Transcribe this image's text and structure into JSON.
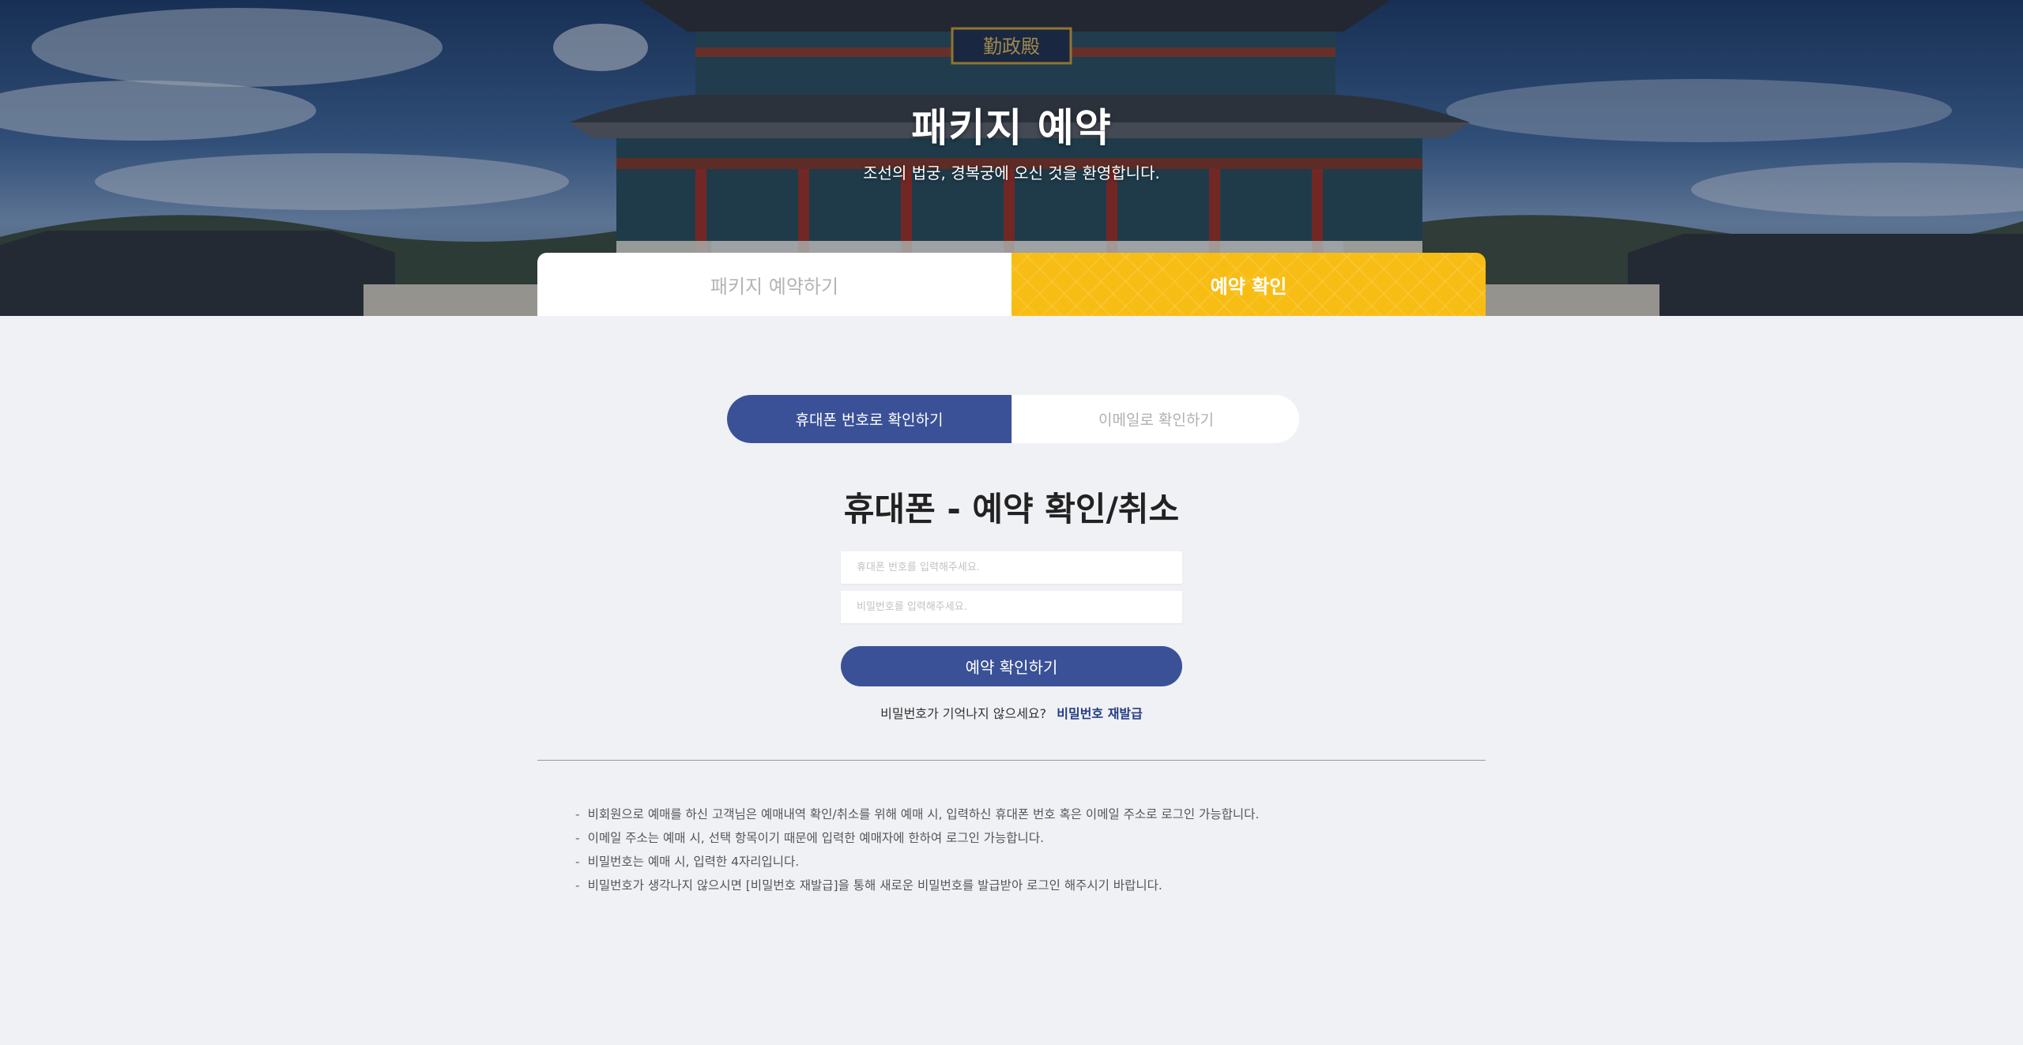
{
  "hero": {
    "title": "패키지 예약",
    "subtitle": "조선의 법궁, 경복궁에 오신 것을 환영합니다.",
    "signboard_text": "勤政殿"
  },
  "main_tabs": [
    {
      "label": "패키지 예약하기",
      "active": false
    },
    {
      "label": "예약 확인",
      "active": true
    }
  ],
  "sub_tabs": [
    {
      "label": "휴대폰 번호로 확인하기",
      "active": true
    },
    {
      "label": "이메일로 확인하기",
      "active": false
    }
  ],
  "form": {
    "title": "휴대폰 - 예약 확인/취소",
    "phone_placeholder": "휴대폰 번호를 입력해주세요.",
    "password_placeholder": "비밀번호를 입력해주세요.",
    "submit_label": "예약 확인하기",
    "forgot_text": "비밀번호가 기억나지 않으세요?",
    "reissue_label": "비밀번호 재발급"
  },
  "notes": [
    "비회원으로 예매를 하신 고객님은 예매내역 확인/취소를 위해 예매 시, 입력하신 휴대폰 번호 혹은 이메일 주소로 로그인 가능합니다.",
    "이메일 주소는 예매 시, 선택 항목이기 때문에 입력한 예매자에 한하여 로그인 가능합니다.",
    "비밀번호는 예매 시, 입력한 4자리입니다.",
    "비밀번호가 생각나지 않으시면 [비밀번호 재발급]을 통해 새로운 비밀번호를 발급받아 로그인 해주시기 바랍니다."
  ],
  "colors": {
    "primary": "#3a5198",
    "accent": "#f8bd14",
    "background": "#f0f1f5",
    "link": "#243d86"
  }
}
